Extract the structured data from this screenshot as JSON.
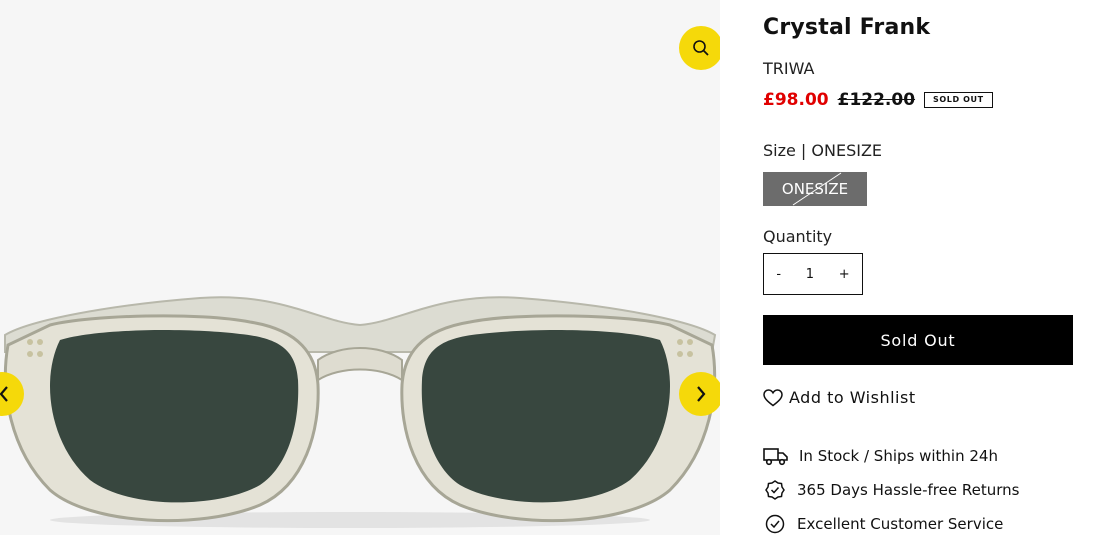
{
  "product": {
    "title": "Crystal Frank",
    "brand": "TRIWA",
    "price": "£98.00",
    "compare_price": "£122.00",
    "badge": "SOLD OUT"
  },
  "size": {
    "label": "Size | ONESIZE",
    "option": "ONESIZE"
  },
  "quantity": {
    "label": "Quantity",
    "minus": "-",
    "value": "1",
    "plus": "+"
  },
  "buttons": {
    "sold_out": "Sold Out",
    "wishlist": "Add to Wishlist"
  },
  "perks": [
    {
      "icon": "delivery-truck-icon",
      "text": "In Stock / Ships within 24h"
    },
    {
      "icon": "verified-badge-icon",
      "text": "365 Days Hassle-free Returns"
    },
    {
      "icon": "check-circle-icon",
      "text": "Excellent Customer Service"
    }
  ],
  "gallery": {
    "icons": [
      "zoom-icon",
      "chevron-left-icon",
      "chevron-right-icon"
    ]
  },
  "colors": {
    "accent": "#f5d90a",
    "sale": "#e00000",
    "button": "#000000",
    "size_option": "#6c6c6c"
  }
}
